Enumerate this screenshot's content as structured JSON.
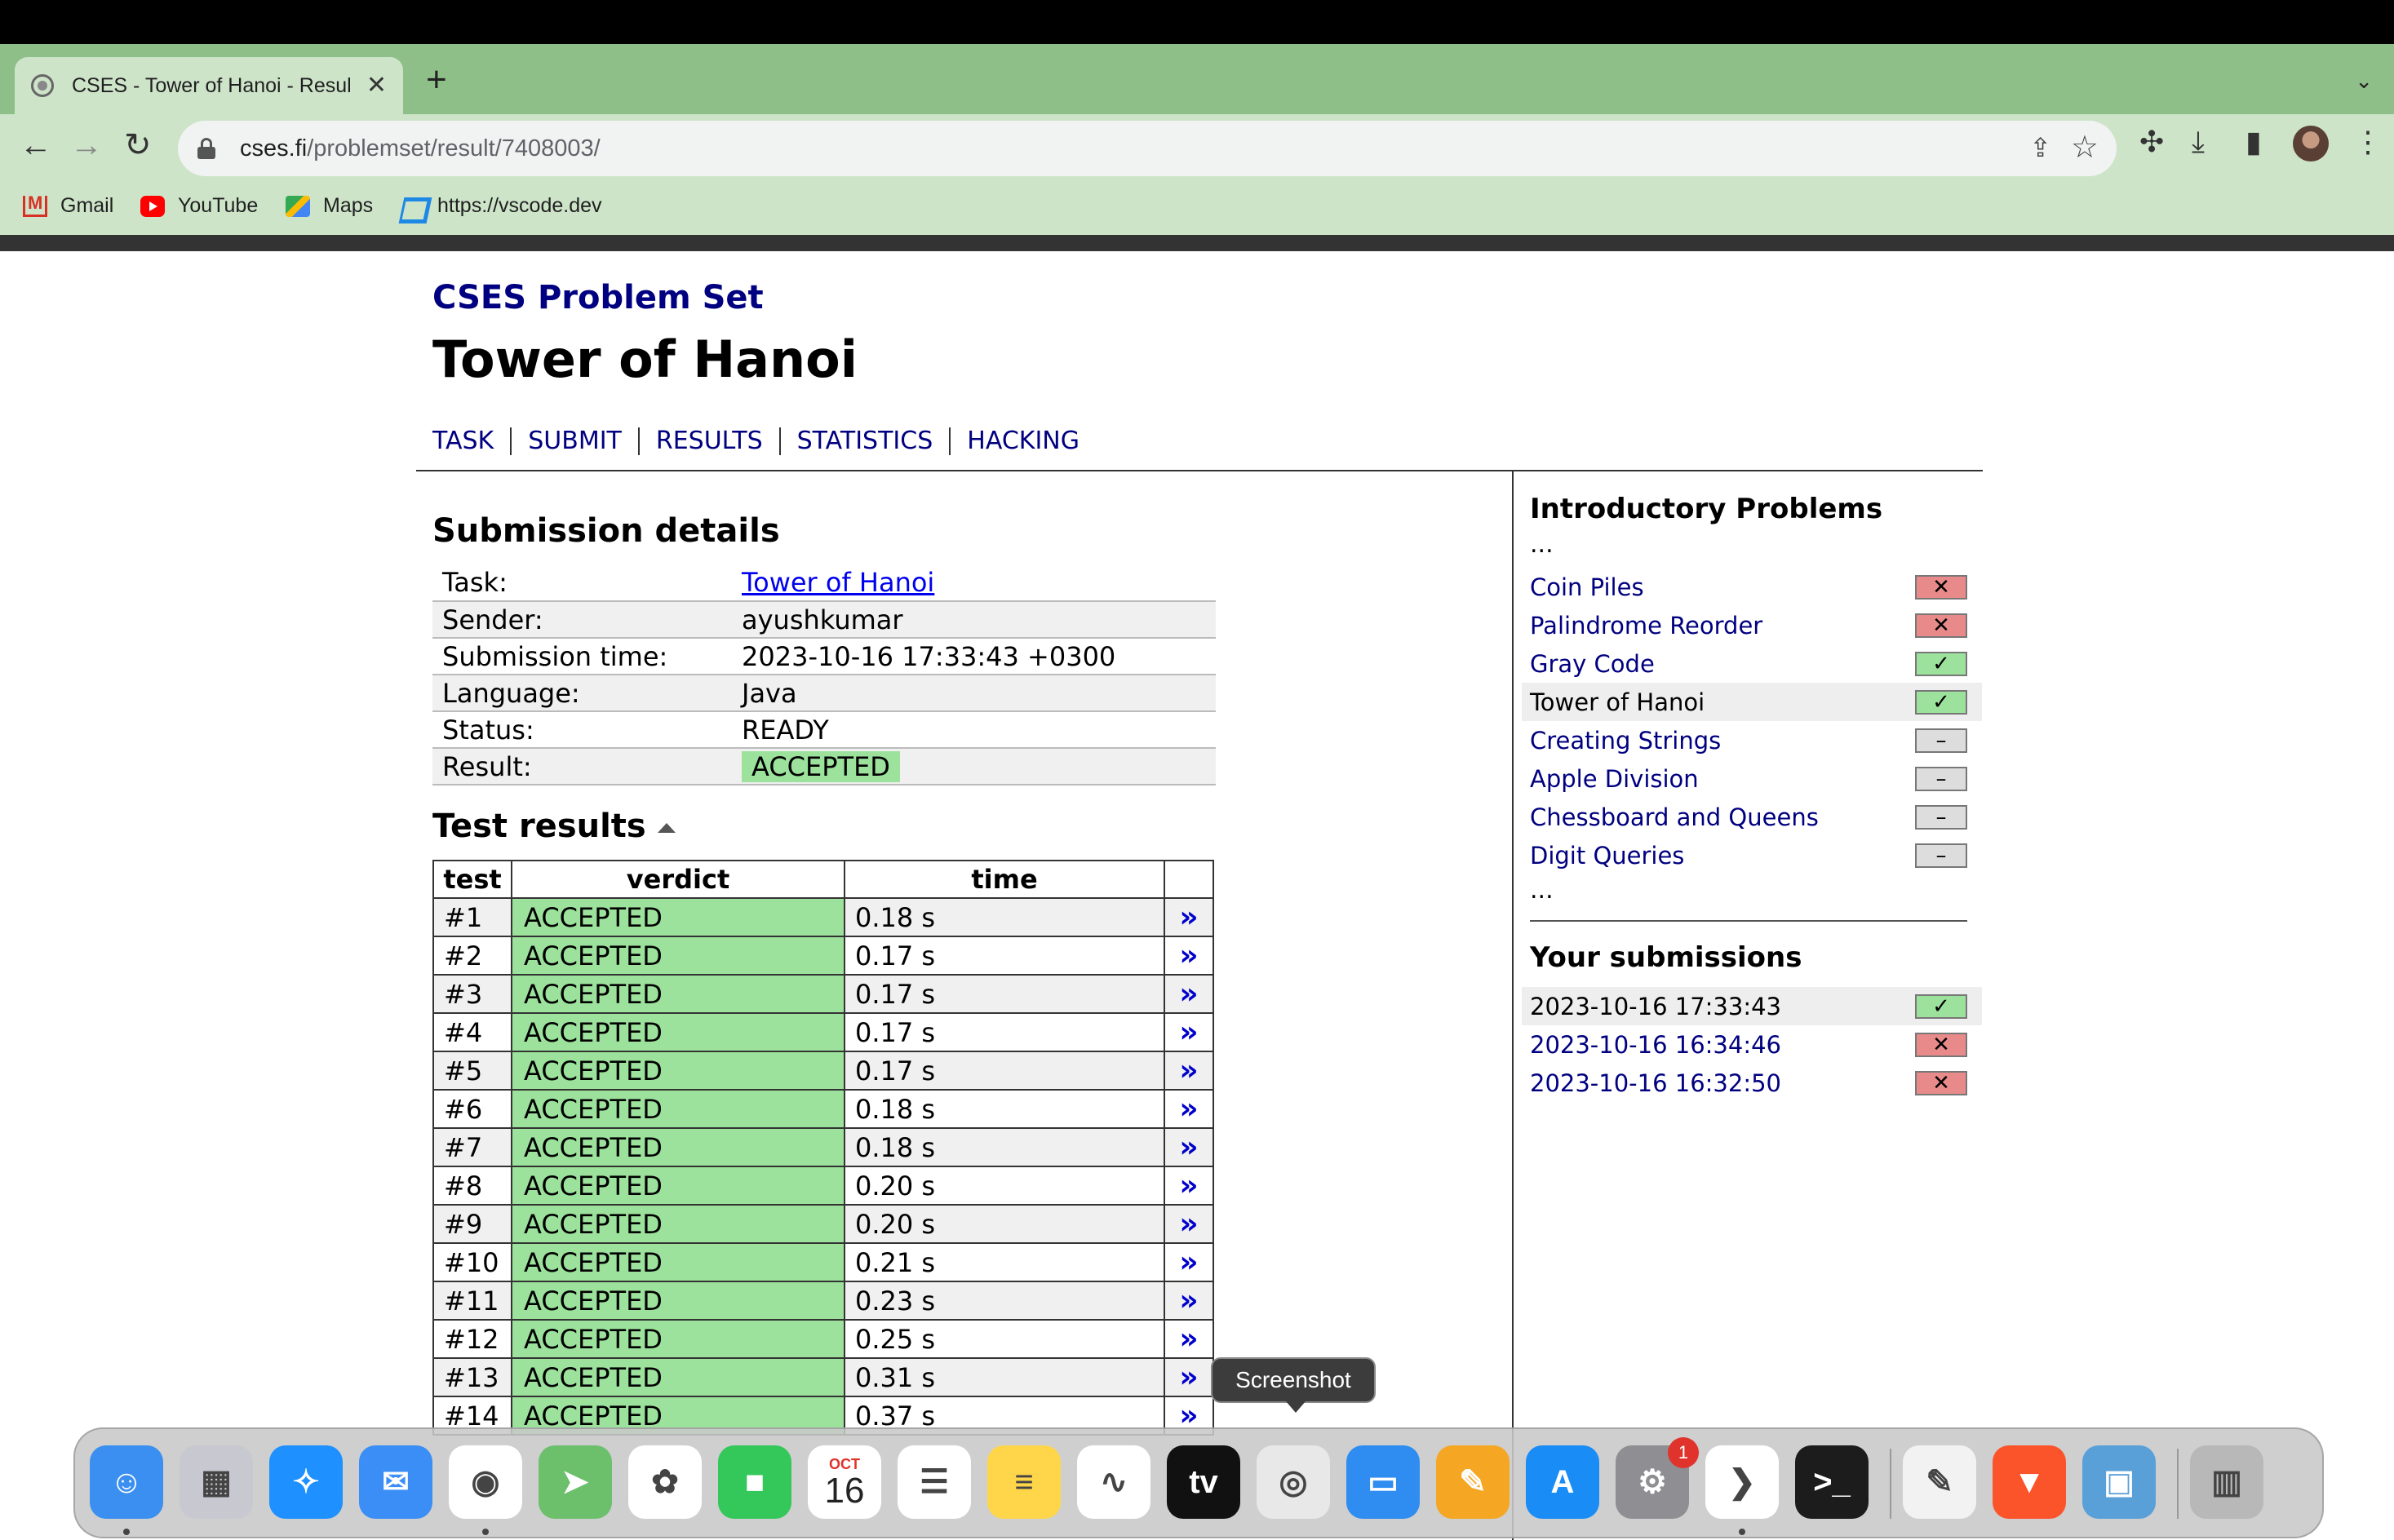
{
  "browser": {
    "tab_title": "CSES - Tower of Hanoi - Resul",
    "tab_close": "✕",
    "new_tab": "+",
    "tab_menu": "⌄",
    "url_host": "cses.fi",
    "url_path": "/problemset/result/7408003/",
    "back": "←",
    "forward": "→",
    "reload": "↻",
    "share": "⇪",
    "star": "☆",
    "extensions": "✣",
    "download": "⤓",
    "side_panel": "▮",
    "menu": "⋮",
    "bookmarks": [
      "Gmail",
      "YouTube",
      "Maps",
      "https://vscode.dev"
    ]
  },
  "page": {
    "site_title": "CSES Problem Set",
    "problem_title": "Tower of Hanoi",
    "nav": [
      "TASK",
      "SUBMIT",
      "RESULTS",
      "STATISTICS",
      "HACKING"
    ],
    "details_heading": "Submission details",
    "details": [
      {
        "label": "Task:",
        "value": "Tower of Hanoi"
      },
      {
        "label": "Sender:",
        "value": "ayushkumar"
      },
      {
        "label": "Submission time:",
        "value": "2023-10-16 17:33:43 +0300"
      },
      {
        "label": "Language:",
        "value": "Java"
      },
      {
        "label": "Status:",
        "value": "READY"
      },
      {
        "label": "Result:",
        "value": "ACCEPTED"
      }
    ],
    "tests_heading": "Test results",
    "test_columns": [
      "test",
      "verdict",
      "time"
    ],
    "tests": [
      {
        "test": "#1",
        "verdict": "ACCEPTED",
        "time": "0.18 s"
      },
      {
        "test": "#2",
        "verdict": "ACCEPTED",
        "time": "0.17 s"
      },
      {
        "test": "#3",
        "verdict": "ACCEPTED",
        "time": "0.17 s"
      },
      {
        "test": "#4",
        "verdict": "ACCEPTED",
        "time": "0.17 s"
      },
      {
        "test": "#5",
        "verdict": "ACCEPTED",
        "time": "0.17 s"
      },
      {
        "test": "#6",
        "verdict": "ACCEPTED",
        "time": "0.18 s"
      },
      {
        "test": "#7",
        "verdict": "ACCEPTED",
        "time": "0.18 s"
      },
      {
        "test": "#8",
        "verdict": "ACCEPTED",
        "time": "0.20 s"
      },
      {
        "test": "#9",
        "verdict": "ACCEPTED",
        "time": "0.20 s"
      },
      {
        "test": "#10",
        "verdict": "ACCEPTED",
        "time": "0.21 s"
      },
      {
        "test": "#11",
        "verdict": "ACCEPTED",
        "time": "0.23 s"
      },
      {
        "test": "#12",
        "verdict": "ACCEPTED",
        "time": "0.25 s"
      },
      {
        "test": "#13",
        "verdict": "ACCEPTED",
        "time": "0.31 s"
      },
      {
        "test": "#14",
        "verdict": "ACCEPTED",
        "time": "0.37 s"
      }
    ],
    "test_link": "»"
  },
  "sidebar": {
    "section_heading": "Introductory Problems",
    "ellipsis": "...",
    "problems": [
      {
        "name": "Coin Piles",
        "status": "fail",
        "current": false
      },
      {
        "name": "Palindrome Reorder",
        "status": "fail",
        "current": false
      },
      {
        "name": "Gray Code",
        "status": "ok",
        "current": false
      },
      {
        "name": "Tower of Hanoi",
        "status": "ok",
        "current": true
      },
      {
        "name": "Creating Strings",
        "status": "none",
        "current": false
      },
      {
        "name": "Apple Division",
        "status": "none",
        "current": false
      },
      {
        "name": "Chessboard and Queens",
        "status": "none",
        "current": false
      },
      {
        "name": "Digit Queries",
        "status": "none",
        "current": false
      }
    ],
    "submissions_heading": "Your submissions",
    "submissions": [
      {
        "time": "2023-10-16 17:33:43",
        "status": "ok",
        "current": true
      },
      {
        "time": "2023-10-16 16:34:46",
        "status": "fail",
        "current": false
      },
      {
        "time": "2023-10-16 16:32:50",
        "status": "fail",
        "current": false
      }
    ],
    "status_glyphs": {
      "ok": "✓",
      "fail": "✕",
      "none": "–"
    }
  },
  "tooltip": "Screenshot",
  "dock": {
    "calendar_month": "OCT",
    "calendar_day": "16",
    "settings_badge": "1",
    "apps": [
      {
        "name": "finder-icon",
        "color": "#3b8ff0"
      },
      {
        "name": "launchpad-icon",
        "color": "#c8c8d0"
      },
      {
        "name": "safari-icon",
        "color": "#1e90ff"
      },
      {
        "name": "mail-icon",
        "color": "#3a8ef6"
      },
      {
        "name": "chrome-icon",
        "color": "#ffffff"
      },
      {
        "name": "maps-icon",
        "color": "#6cc06c"
      },
      {
        "name": "photos-icon",
        "color": "#ffffff"
      },
      {
        "name": "facetime-icon",
        "color": "#34c759"
      },
      {
        "name": "calendar-icon",
        "color": "#ffffff"
      },
      {
        "name": "reminders-icon",
        "color": "#ffffff"
      },
      {
        "name": "notes-icon",
        "color": "#ffd54a"
      },
      {
        "name": "freeform-icon",
        "color": "#ffffff"
      },
      {
        "name": "apple-tv-icon",
        "color": "#111111"
      },
      {
        "name": "screenshot-icon",
        "color": "#e8e8e8"
      },
      {
        "name": "keynote-icon",
        "color": "#2f8cf0"
      },
      {
        "name": "pages-icon",
        "color": "#f5a623"
      },
      {
        "name": "app-store-icon",
        "color": "#1a8cf5"
      },
      {
        "name": "system-settings-icon",
        "color": "#8e8e93"
      },
      {
        "name": "vscode-icon",
        "color": "#ffffff"
      },
      {
        "name": "terminal-icon",
        "color": "#1c1c1c"
      },
      {
        "name": "textedit-icon",
        "color": "#f2f2f2"
      },
      {
        "name": "brave-icon",
        "color": "#fb542b"
      },
      {
        "name": "preview-icon",
        "color": "#5aa0d8"
      },
      {
        "name": "trash-icon",
        "color": "#b8b8b8"
      }
    ],
    "glyphs": {
      "launchpad-icon": "▦",
      "safari-icon": "✧",
      "mail-icon": "✉",
      "chrome-icon": "◉",
      "maps-icon": "➤",
      "photos-icon": "✿",
      "facetime-icon": "■",
      "reminders-icon": "☰",
      "notes-icon": "≡",
      "freeform-icon": "∿",
      "apple-tv-icon": "tv",
      "screenshot-icon": "◎",
      "keynote-icon": "▭",
      "pages-icon": "✎",
      "app-store-icon": "A",
      "system-settings-icon": "⚙",
      "vscode-icon": "❯",
      "terminal-icon": ">_",
      "textedit-icon": "✎",
      "brave-icon": "▼",
      "preview-icon": "▣",
      "trash-icon": "▥",
      "finder-icon": "☺"
    }
  }
}
